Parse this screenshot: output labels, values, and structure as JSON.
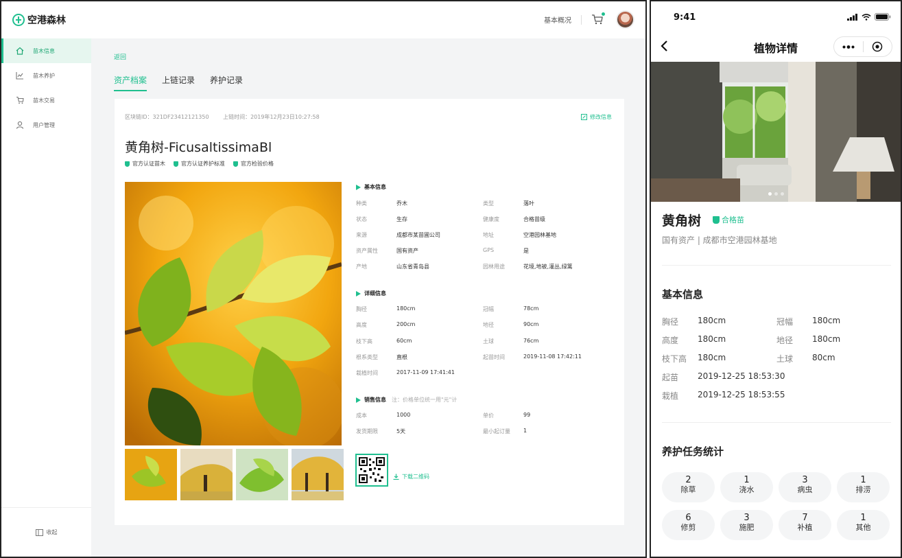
{
  "desktop": {
    "app_name": "空港森林",
    "header": {
      "overview_link": "基本概况"
    },
    "sidebar": {
      "items": [
        {
          "label": "苗木信息",
          "icon": "home-icon",
          "active": true
        },
        {
          "label": "苗木养护",
          "icon": "chart-icon",
          "active": false
        },
        {
          "label": "苗木交易",
          "icon": "cart-icon",
          "active": false
        },
        {
          "label": "用户管理",
          "icon": "user-icon",
          "active": false
        }
      ],
      "collapse_label": "收起"
    },
    "back_label": "返回",
    "tabs": [
      "资产档案",
      "上链记录",
      "养护记录"
    ],
    "active_tab": "资产档案",
    "card": {
      "block_id": "区块链ID：321DF23412121350",
      "chain_time": "上链时间：2019年12月23日10:27:58",
      "edit_label": "修改信息",
      "title": "黄角树-FicusaltissimaBl",
      "badges": [
        "官方认证苗木",
        "官方认证养护标准",
        "官方检验价格"
      ],
      "basic": {
        "title": "基本信息",
        "rows": [
          [
            {
              "k": "种类",
              "v": "乔木"
            },
            {
              "k": "类型",
              "v": "落叶"
            }
          ],
          [
            {
              "k": "状态",
              "v": "生存"
            },
            {
              "k": "健康度",
              "v": "合格苗级"
            }
          ],
          [
            {
              "k": "来源",
              "v": "成都市某苗圃公司"
            },
            {
              "k": "地址",
              "v": "空港园林基地"
            }
          ],
          [
            {
              "k": "资产属性",
              "v": "国有资产"
            },
            {
              "k": "GPS",
              "v": "是"
            }
          ],
          [
            {
              "k": "产地",
              "v": "山东省青岛县"
            },
            {
              "k": "园林用途",
              "v": "花境,地被,灌丛,绿篱"
            }
          ]
        ]
      },
      "detail": {
        "title": "详细信息",
        "rows": [
          [
            {
              "k": "胸径",
              "v": "180cm"
            },
            {
              "k": "冠幅",
              "v": "78cm"
            }
          ],
          [
            {
              "k": "高度",
              "v": "200cm"
            },
            {
              "k": "地径",
              "v": "90cm"
            }
          ],
          [
            {
              "k": "枝下高",
              "v": "60cm"
            },
            {
              "k": "土球",
              "v": "76cm"
            }
          ],
          [
            {
              "k": "根系类型",
              "v": "直根"
            },
            {
              "k": "起苗时间",
              "v": "2019-11-08 17:42:11"
            }
          ],
          [
            {
              "k": "栽植时间",
              "v": "2017-11-09 17:41:41"
            },
            null
          ]
        ]
      },
      "sales": {
        "title": "销售信息",
        "hint": "注：价格单位统一用\"元\"计",
        "rows": [
          [
            {
              "k": "成本",
              "v": "1000"
            },
            {
              "k": "单价",
              "v": "99"
            }
          ],
          [
            {
              "k": "发货期限",
              "v": "5天"
            },
            {
              "k": "最小起订量",
              "v": "1"
            }
          ]
        ]
      },
      "download_label": "下载二维码"
    }
  },
  "mobile": {
    "status_time": "9:41",
    "nav_title": "植物详情",
    "name": "黄角树",
    "qualified": "合格苗",
    "subtitle": "国有资产 | 成都市空港园林基地",
    "basic_title": "基本信息",
    "basic": [
      [
        {
          "k": "胸径",
          "v": "180cm"
        },
        {
          "k": "冠幅",
          "v": "180cm"
        }
      ],
      [
        {
          "k": "高度",
          "v": "180cm"
        },
        {
          "k": "地径",
          "v": "180cm"
        }
      ],
      [
        {
          "k": "枝下高",
          "v": "180cm"
        },
        {
          "k": "土球",
          "v": "80cm"
        }
      ],
      [
        {
          "k": "起苗",
          "v": "2019-12-25 18:53:30"
        },
        null
      ],
      [
        {
          "k": "栽植",
          "v": "2019-12-25 18:53:55"
        },
        null
      ]
    ],
    "tasks_title": "养护任务统计",
    "tasks": [
      {
        "n": "2",
        "l": "除草"
      },
      {
        "n": "1",
        "l": "浇水"
      },
      {
        "n": "3",
        "l": "病虫"
      },
      {
        "n": "1",
        "l": "排涝"
      },
      {
        "n": "6",
        "l": "修剪"
      },
      {
        "n": "3",
        "l": "施肥"
      },
      {
        "n": "7",
        "l": "补植"
      },
      {
        "n": "1",
        "l": "其他"
      }
    ]
  },
  "colors": {
    "accent": "#1fbf8f",
    "active_bg": "#e6f6ef"
  }
}
